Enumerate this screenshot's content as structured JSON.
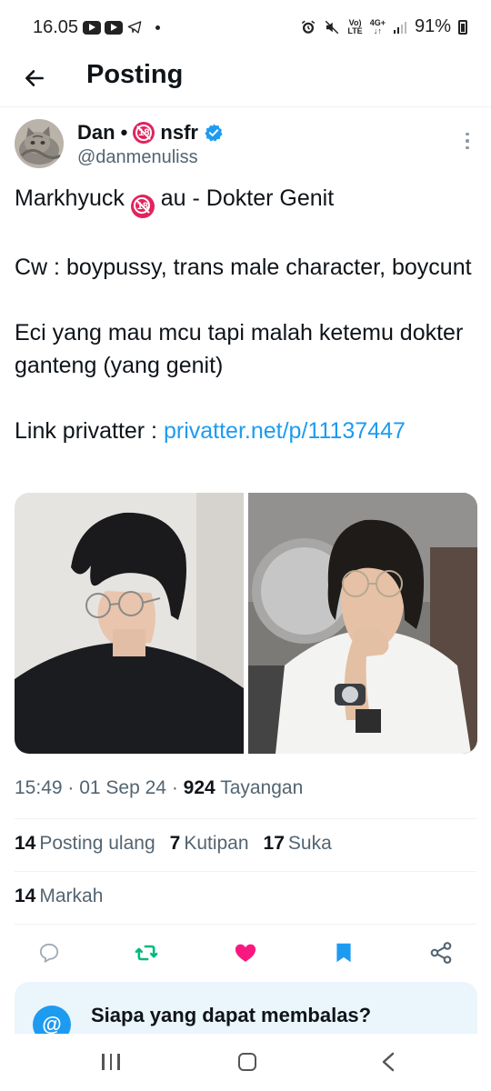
{
  "status_bar": {
    "time": "16.05",
    "network_top": "Vo)",
    "network_bottom": "LTE",
    "data_top": "4G+",
    "data_bottom": "↓↑",
    "battery": "91%"
  },
  "header": {
    "title": "Posting",
    "back_icon": "arrow-left-icon"
  },
  "author": {
    "name": "Dan •",
    "name_suffix": "nsfr",
    "badge_icon": "no-under-18-icon",
    "verified_icon": "verified-badge-icon",
    "handle": "@danmenuliss"
  },
  "tweet": {
    "line1_before": "Markhyuck",
    "line1_after": "au - Dokter Genit",
    "paragraph2": "Cw : boypussy, trans male character, boycunt",
    "paragraph3": "Eci yang mau mcu tapi malah ketemu dokter ganteng (yang genit)",
    "link_prefix": "Link privatter :",
    "link_text": "privatter.net/p/11137447"
  },
  "meta": {
    "time": "15:49",
    "date": "01 Sep 24",
    "views_count": "924",
    "views_label": "Tayangan"
  },
  "stats": {
    "reposts_count": "14",
    "reposts_label": "Posting ulang",
    "quotes_count": "7",
    "quotes_label": "Kutipan",
    "likes_count": "17",
    "likes_label": "Suka",
    "bookmarks_count": "14",
    "bookmarks_label": "Markah"
  },
  "actions": {
    "reply_icon": "reply-icon",
    "repost_icon": "repost-icon",
    "like_icon": "heart-icon",
    "bookmark_icon": "bookmark-icon",
    "share_icon": "share-icon",
    "repost_color": "#00ba7c",
    "like_color": "#f91880",
    "bookmark_color": "#1d9bf0"
  },
  "reply_card": {
    "icon_text": "@",
    "title": "Siapa yang dapat membalas?"
  },
  "colors": {
    "accent": "#1d9bf0",
    "text_primary": "#0f1419",
    "text_secondary": "#536471"
  }
}
